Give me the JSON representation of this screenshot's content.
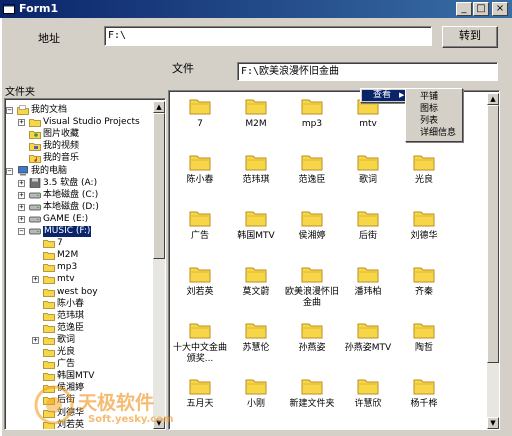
{
  "window": {
    "title": "Form1",
    "minimize": "_",
    "maximize": "□",
    "close": "×"
  },
  "address": {
    "label": "地址",
    "value": "F:\\",
    "go": "转到"
  },
  "file": {
    "label": "文件",
    "value": "F:\\欧美浪漫怀旧金曲"
  },
  "tree": {
    "header": "文件夹",
    "rows": [
      {
        "text": "我的文档",
        "icon": "folder-open"
      },
      {
        "text": "Visual Studio Projects",
        "icon": "folder"
      },
      {
        "text": "图片收藏",
        "icon": "pictures"
      },
      {
        "text": "我的视频",
        "icon": "video"
      },
      {
        "text": "我的音乐",
        "icon": "music"
      },
      {
        "text": "我的电脑",
        "icon": "computer"
      },
      {
        "text": "3.5 软盘 (A:)",
        "icon": "floppy"
      },
      {
        "text": "本地磁盘 (C:)",
        "icon": "disk"
      },
      {
        "text": "本地磁盘 (D:)",
        "icon": "disk"
      },
      {
        "text": "GAME (E:)",
        "icon": "disk"
      },
      {
        "text": "MUSIC (F:)",
        "icon": "disk"
      },
      {
        "text": "7",
        "icon": "folder"
      },
      {
        "text": "M2M",
        "icon": "folder"
      },
      {
        "text": "mp3",
        "icon": "folder"
      },
      {
        "text": "mtv",
        "icon": "folder"
      },
      {
        "text": "west boy",
        "icon": "folder"
      },
      {
        "text": "陈小春",
        "icon": "folder"
      },
      {
        "text": "范玮琪",
        "icon": "folder"
      },
      {
        "text": "范逸臣",
        "icon": "folder"
      },
      {
        "text": "歌词",
        "icon": "folder"
      },
      {
        "text": "光良",
        "icon": "folder"
      },
      {
        "text": "广告",
        "icon": "folder"
      },
      {
        "text": "韩国MTV",
        "icon": "folder"
      },
      {
        "text": "侯湘婷",
        "icon": "folder"
      },
      {
        "text": "后街",
        "icon": "folder"
      },
      {
        "text": "刘德华",
        "icon": "folder"
      },
      {
        "text": "刘若英",
        "icon": "folder"
      }
    ]
  },
  "files": [
    "7",
    "M2M",
    "mp3",
    "mtv",
    "",
    "陈小春",
    "范玮琪",
    "范逸臣",
    "歌词",
    "光良",
    "广告",
    "韩国MTV",
    "侯湘婷",
    "后街",
    "刘德华",
    "刘若英",
    "莫文蔚",
    "欧美浪漫怀旧金曲",
    "潘玮柏",
    "齐秦",
    "十大中文金曲颁奖...",
    "苏慧伦",
    "孙燕姿",
    "孙燕姿MTV",
    "陶哲",
    "五月天",
    "小刚",
    "新建文件夹",
    "许慧欣",
    "杨千桦"
  ],
  "context_menu": {
    "root": "查看",
    "items": [
      "平铺",
      "图标",
      "列表",
      "详细信息"
    ]
  },
  "watermark": {
    "line1": "天极软件",
    "line2": "Soft.yesky.com"
  },
  "colors": {
    "titlebar": "#0a246a",
    "selection": "#0a246a",
    "folder": "#f7d64a"
  }
}
